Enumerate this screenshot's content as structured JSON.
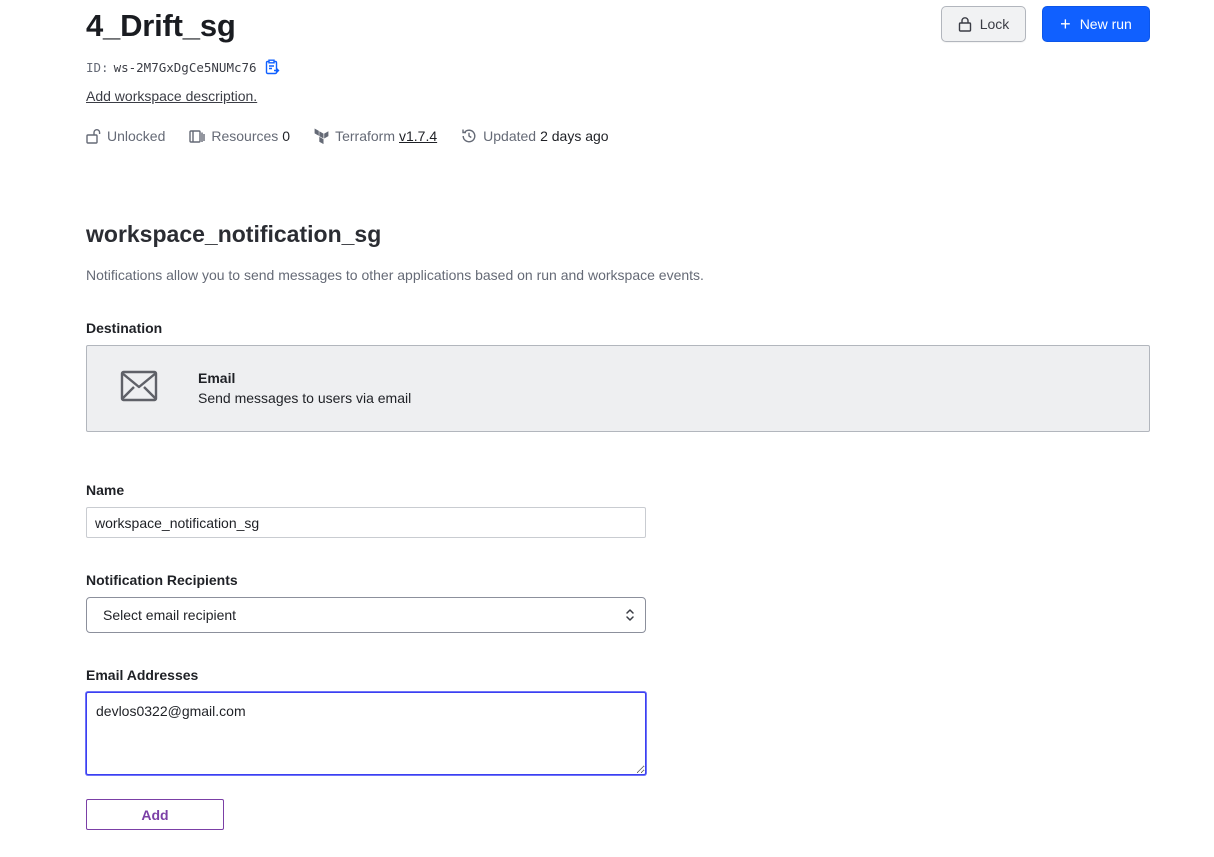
{
  "workspace": {
    "title": "4_Drift_sg",
    "id_label": "ID:",
    "id_value": "ws-2M7GxDgCe5NUMc76",
    "add_description": "Add workspace description.",
    "meta": {
      "lock_status": "Unlocked",
      "resources_label": "Resources",
      "resources_count": "0",
      "terraform_label": "Terraform",
      "terraform_version": "v1.7.4",
      "updated_label": "Updated",
      "updated_value": "2 days ago"
    },
    "actions": {
      "lock_label": "Lock",
      "new_run_label": "New run"
    }
  },
  "notification": {
    "title": "workspace_notification_sg",
    "description": "Notifications allow you to send messages to other applications based on run and workspace events.",
    "destination_label": "Destination",
    "destination": {
      "name": "Email",
      "description": "Send messages to users via email",
      "icon": "envelope-icon"
    },
    "name_label": "Name",
    "name_value": "workspace_notification_sg",
    "recipients_label": "Notification Recipients",
    "recipients_selected": "Select email recipient",
    "emails_label": "Email Addresses",
    "emails_value": "devlos0322@gmail.com",
    "add_label": "Add"
  },
  "colors": {
    "primary_button": "#1060ff",
    "add_button": "#7b3fa6",
    "focus_border": "#3b3ff2",
    "copy_icon": "#1060ff"
  }
}
